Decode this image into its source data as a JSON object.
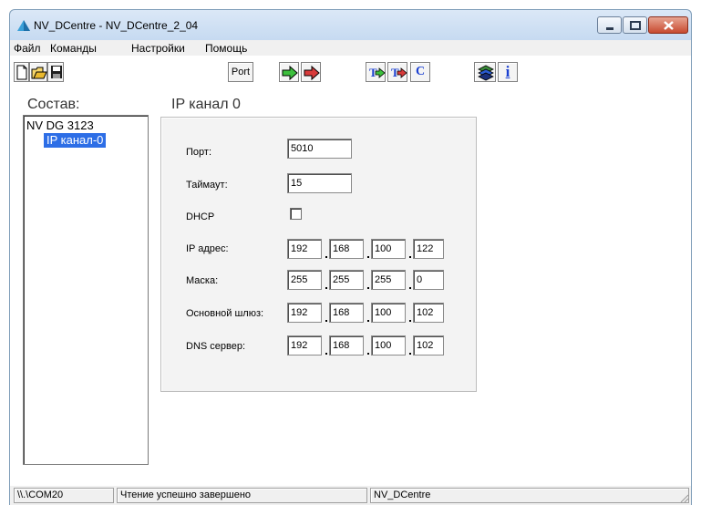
{
  "window": {
    "title": "NV_DCentre - NV_DCentre_2_04"
  },
  "menu": [
    "Файл",
    "Команды",
    "Настройки",
    "Помощь"
  ],
  "toolbar": {
    "port_label": "Port",
    "c_label": "C",
    "info_label": "i"
  },
  "tree": {
    "heading": "Состав:",
    "root": "NV DG 3123",
    "child": "IP канал-0"
  },
  "panel": {
    "title": "IP канал 0",
    "port_label": "Порт:",
    "port_value": "5010",
    "timeout_label": "Таймаут:",
    "timeout_value": "15",
    "dhcp_label": "DHCP",
    "ip_label": "IP адрес:",
    "ip": [
      "192",
      "168",
      "100",
      "122"
    ],
    "mask_label": "Маска:",
    "mask": [
      "255",
      "255",
      "255",
      "0"
    ],
    "gateway_label": "Основной шлюз:",
    "gateway": [
      "192",
      "168",
      "100",
      "102"
    ],
    "dns_label": "DNS сервер:",
    "dns": [
      "192",
      "168",
      "100",
      "102"
    ]
  },
  "status": {
    "port": "\\\\.\\COM20",
    "message": "Чтение успешно завершено",
    "app": "NV_DCentre"
  },
  "colors": {
    "selection": "#2d6ee6",
    "panel_bg": "#f3f3f3",
    "toolbar_blue": "#1a3fd1"
  }
}
